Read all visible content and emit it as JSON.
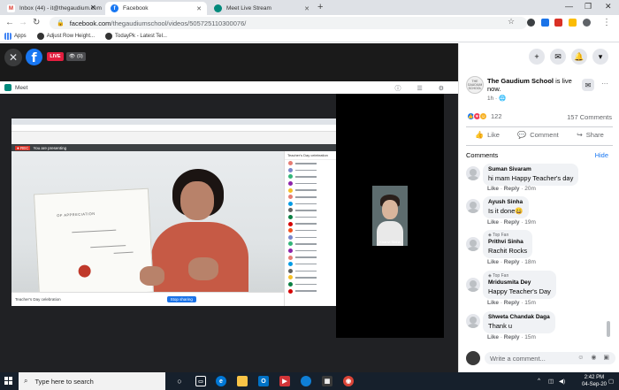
{
  "browser": {
    "tabs": [
      {
        "title": "Inbox (44) - it@thegaudium.com",
        "favicon": "gmail-icon"
      },
      {
        "title": "Facebook",
        "favicon": "facebook-icon"
      },
      {
        "title": "Meet Live Stream",
        "favicon": "meet-icon"
      }
    ],
    "url_host": "facebook.com",
    "url_path": "/thegaudiumschool/videos/505725110300076/",
    "bookmarks": [
      "Apps",
      "Adjust Row Height...",
      "TodayPk - Latest Tel..."
    ]
  },
  "video": {
    "live_label": "LIVE",
    "viewers": "(0)",
    "meet_label": "Meet",
    "presenting_label": "You are presenting",
    "teacher_name": "Teacher's Day celebration",
    "foot_pill": "Stop sharing",
    "certificate_text": "OF APPRECIATION",
    "kid_name": "Kiranvi Sinha"
  },
  "post": {
    "page_name": "The Gaudium School",
    "status": " is live now.",
    "time": "1h · ",
    "avatar_text": "THE GAUDIUM SCHOOL",
    "reaction_count": "122",
    "comment_count": "157 Comments",
    "actions": [
      "Like",
      "Comment",
      "Share"
    ]
  },
  "comments_section": {
    "title": "Comments",
    "hide": "Hide",
    "items": [
      {
        "name": "Suman Sivaram",
        "text": "hi mam Happy Teacher's day",
        "time": "20m",
        "fan": ""
      },
      {
        "name": "Ayush Sinha",
        "text": "Is it done😀",
        "time": "19m",
        "fan": ""
      },
      {
        "name": "Prithvi Sinha",
        "text": "Rachit Rocks",
        "time": "18m",
        "fan": "Top Fan"
      },
      {
        "name": "Mridusmita Dey",
        "text": "Happy Teacher's Day",
        "time": "15m",
        "fan": "Top Fan"
      },
      {
        "name": "Shweta Chandak Daga",
        "text": "Thank u",
        "time": "15m",
        "fan": ""
      }
    ],
    "like_label": "Like",
    "reply_label": "Reply",
    "write_placeholder": "Write a comment..."
  },
  "taskbar": {
    "search_placeholder": "Type here to search",
    "time": "2:42 PM",
    "date": "04-Sep-20"
  }
}
